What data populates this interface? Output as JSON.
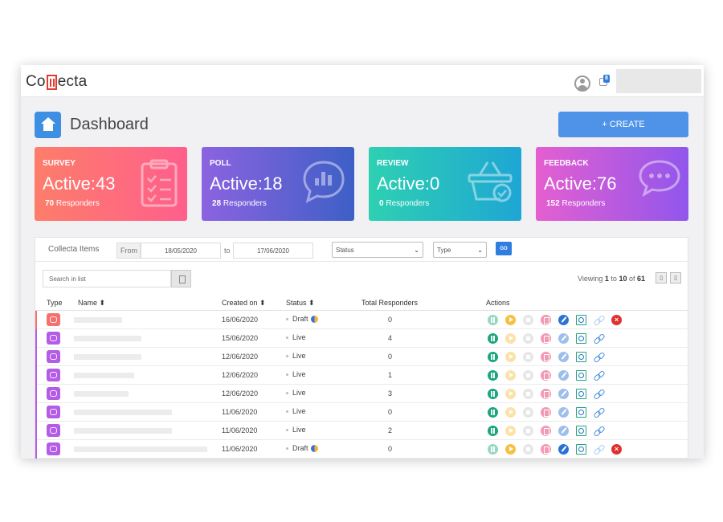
{
  "app": {
    "logo_prefix": "Co",
    "logo_suffix": "ecta",
    "notification_count": "8"
  },
  "header": {
    "title": "Dashboard",
    "create_label": "+ CREATE"
  },
  "cards": [
    {
      "label": "SURVEY",
      "active": "Active:43",
      "count": "70",
      "unit": "Responders"
    },
    {
      "label": "POLL",
      "active": "Active:18",
      "count": "28",
      "unit": "Responders"
    },
    {
      "label": "REVIEW",
      "active": "Active:0",
      "count": "0",
      "unit": "Responders"
    },
    {
      "label": "FEEDBACK",
      "active": "Active:76",
      "count": "152",
      "unit": "Responders"
    }
  ],
  "filters": {
    "title": "Collecta Items",
    "from_label": "From",
    "from_value": "18/05/2020",
    "to_label": "to",
    "to_value": "17/06/2020",
    "status_value": "Status",
    "type_value": "Type",
    "go_label": "GO",
    "search_placeholder": "Search in list"
  },
  "pagination": {
    "viewing": "Viewing",
    "start": "1",
    "to": "to",
    "end": "10",
    "of": "of",
    "total": "61"
  },
  "table": {
    "headers": [
      "Type",
      "Name ⬍",
      "Created on ⬍",
      "Status ⬍",
      "Total Responders",
      "Actions"
    ],
    "rows": [
      {
        "type": "survey",
        "created": "16/06/2020",
        "status": "Draft",
        "responders": "0"
      },
      {
        "type": "feedback",
        "created": "15/06/2020",
        "status": "Live",
        "responders": "4"
      },
      {
        "type": "feedback",
        "created": "12/06/2020",
        "status": "Live",
        "responders": "0"
      },
      {
        "type": "feedback",
        "created": "12/06/2020",
        "status": "Live",
        "responders": "1"
      },
      {
        "type": "feedback",
        "created": "12/06/2020",
        "status": "Live",
        "responders": "3"
      },
      {
        "type": "feedback",
        "created": "11/06/2020",
        "status": "Live",
        "responders": "0"
      },
      {
        "type": "feedback",
        "created": "11/06/2020",
        "status": "Live",
        "responders": "2"
      },
      {
        "type": "feedback",
        "created": "11/06/2020",
        "status": "Draft",
        "responders": "0"
      }
    ]
  },
  "colors": {
    "survey": "#f5706f",
    "feedback": "#b45ce6",
    "accent": "#4e93e8"
  },
  "icons": [
    "user-icon",
    "notification-icon",
    "home-icon",
    "clipboard-icon",
    "poll-chat-icon",
    "basket-check-icon",
    "speech-bubbles-icon",
    "search-icon",
    "pause-icon",
    "play-icon",
    "stop-icon",
    "copy-icon",
    "edit-icon",
    "report-icon",
    "link-icon",
    "delete-icon"
  ]
}
